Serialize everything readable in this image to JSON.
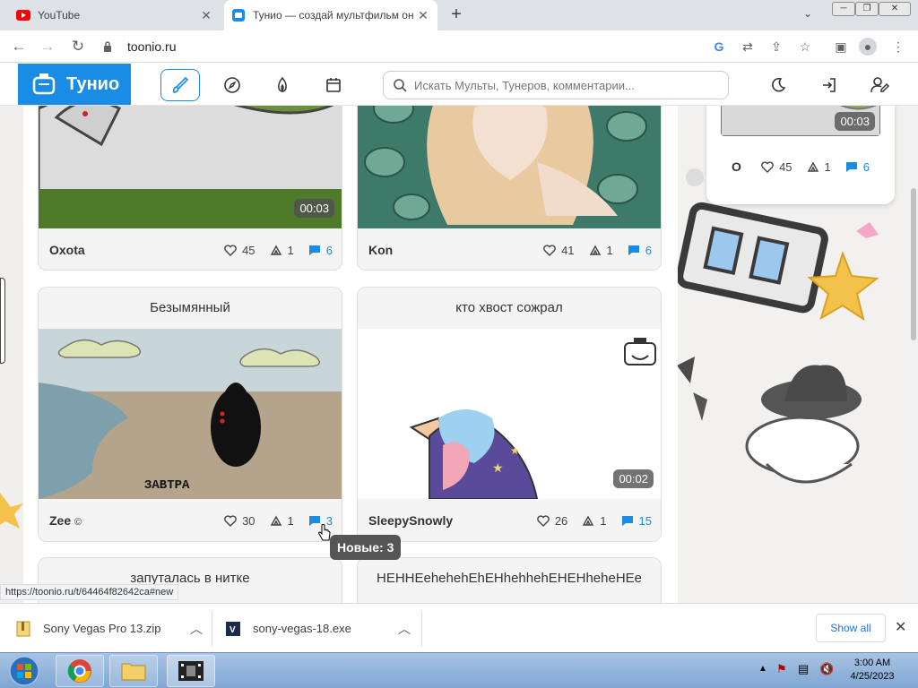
{
  "browser": {
    "tabs": [
      {
        "title": "YouTube",
        "active": false
      },
      {
        "title": "Тунио — создай мультфильм он",
        "active": true
      }
    ],
    "url": "toonio.ru"
  },
  "site": {
    "logo": "Тунио",
    "search_placeholder": "Искать Мульты, Тунеров, комментарии..."
  },
  "cards": [
    {
      "title": "",
      "author": "Oxota",
      "likes": "45",
      "reposts": "1",
      "comments": "6",
      "duration": "00:03"
    },
    {
      "title": "",
      "author": "Kon",
      "likes": "41",
      "reposts": "1",
      "comments": "6",
      "duration": ""
    },
    {
      "title": "Безымянный",
      "author": "Zee",
      "author_mark": "©",
      "likes": "30",
      "reposts": "1",
      "comments": "3",
      "duration": "",
      "thumb_caption": "ЗАВТРА"
    },
    {
      "title": "кто хвост сожрал",
      "author": "SleepySnowly",
      "likes": "26",
      "reposts": "1",
      "comments": "15",
      "duration": "00:02"
    },
    {
      "title": "запуталась в нитке"
    },
    {
      "title": "HEHHEehehehEhEHhehhehEHEHheheHEe"
    }
  ],
  "side_card": {
    "author": "O",
    "likes": "45",
    "reposts": "1",
    "comments": "6",
    "duration": "00:03"
  },
  "tooltip": "Новые: 3",
  "status_url": "https://toonio.ru/t/64464f82642ca#new",
  "downloads": [
    {
      "name": "Sony Vegas Pro 13.zip"
    },
    {
      "name": "sony-vegas-18.exe"
    }
  ],
  "downloads_show_all": "Show all",
  "clock": {
    "time": "3:00 AM",
    "date": "4/25/2023"
  },
  "colors": {
    "accent": "#1a8ce6",
    "comment": "#1a8ce6"
  }
}
